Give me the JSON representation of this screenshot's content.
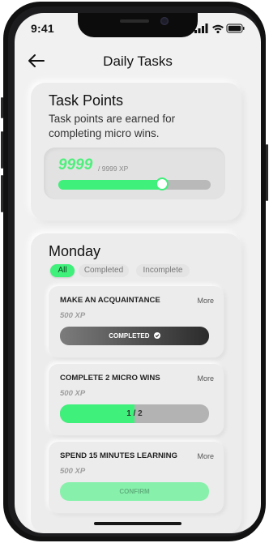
{
  "status_bar": {
    "time": "9:41"
  },
  "header": {
    "title": "Daily Tasks",
    "back_icon": "arrow-left-icon"
  },
  "points": {
    "title": "Task Points",
    "description": "Task points are earned for completing micro wins.",
    "current": "9999",
    "max_label": "/ 9999 XP",
    "progress": 0.68
  },
  "monday": {
    "title": "Monday",
    "filters": [
      {
        "label": "All",
        "active": true
      },
      {
        "label": "Completed",
        "active": false
      },
      {
        "label": "Incomplete",
        "active": false
      }
    ]
  },
  "tasks": [
    {
      "title": "MAKE AN ACQUAINTANCE",
      "more": "More",
      "xp": "500 XP",
      "button": "COMPLETED",
      "state": "completed"
    },
    {
      "title": "COMPLETE 2 MICRO WINS",
      "more": "More",
      "xp": "500 XP",
      "progress_text": "1 / 2",
      "progress": 0.5,
      "state": "in-progress"
    },
    {
      "title": "SPEND 15 MINUTES LEARNING",
      "more": "More",
      "xp": "500 XP",
      "button": "CONFIRM",
      "state": "confirm"
    }
  ],
  "colors": {
    "accent": "#3ff07a",
    "background": "#f1f1f1"
  }
}
